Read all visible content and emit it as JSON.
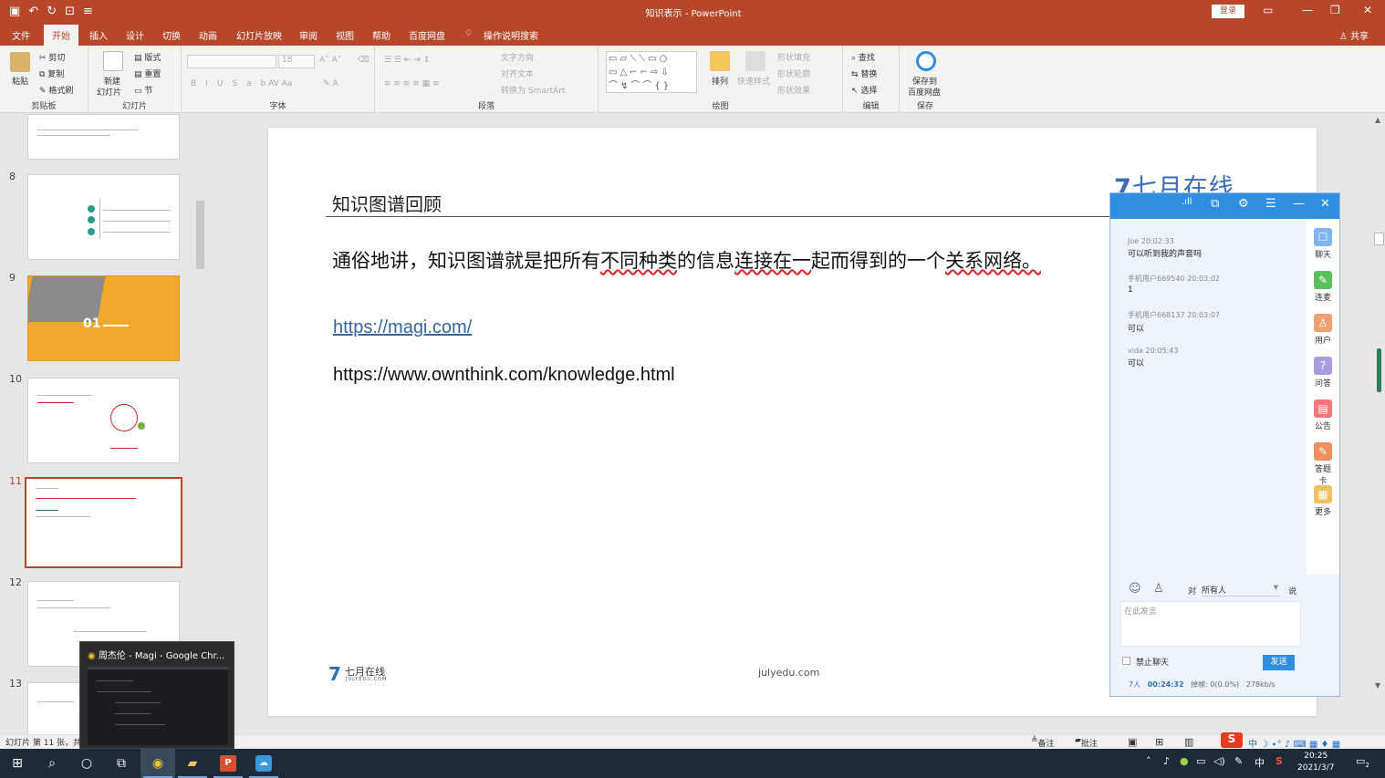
{
  "window": {
    "title": "知识表示 - PowerPoint",
    "login": "登录",
    "qat_icons": [
      "save-icon",
      "undo-icon",
      "redo-icon",
      "present-icon",
      "customize-icon"
    ]
  },
  "tabs": [
    "文件",
    "开始",
    "插入",
    "设计",
    "切换",
    "动画",
    "幻灯片放映",
    "审阅",
    "视图",
    "帮助",
    "百度网盘",
    "操作说明搜索"
  ],
  "share": "共享",
  "ribbon": {
    "clipboard": {
      "paste": "粘贴",
      "cut": "剪切",
      "copy": "复制",
      "format_painter": "格式刷",
      "label": "剪贴板"
    },
    "slides": {
      "new_slide": "新建",
      "new_slide2": "幻灯片",
      "layout": "版式",
      "reset": "重置",
      "section": "节",
      "label": "幻灯片"
    },
    "font": {
      "size": "18",
      "label": "字体"
    },
    "paragraph": {
      "text_direction": "文字方向",
      "align_text": "对齐文本",
      "smartart": "转换为 SmartArt",
      "label": "段落"
    },
    "drawing": {
      "arrange": "排列",
      "quick_styles": "快速样式",
      "fill": "形状填充",
      "outline": "形状轮廓",
      "effects": "形状效果",
      "label": "绘图"
    },
    "editing": {
      "find": "查找",
      "replace": "替换",
      "select": "选择",
      "label": "编辑"
    },
    "save": {
      "line1": "保存到",
      "line2": "百度网盘",
      "label": "保存"
    }
  },
  "thumbnails": [
    {
      "num": "8"
    },
    {
      "num": "9",
      "text": "01"
    },
    {
      "num": "10"
    },
    {
      "num": "11"
    },
    {
      "num": "12"
    },
    {
      "num": "13"
    }
  ],
  "slide": {
    "title": "知识图谱回顾",
    "body_parts": [
      "通俗地讲，知识图谱就是把所有",
      "不同种类",
      "的信息",
      "连接在一",
      "起而得到的一个",
      "关系网络。"
    ],
    "link": "https://magi.com/",
    "url2": "https://www.ownthink.com/knowledge.html",
    "brand": "七月在线",
    "footer_brand": "七月在线",
    "footer_sub": "JULYEDU.COM",
    "footer_url": "julyedu.com"
  },
  "chat": {
    "messages": [
      {
        "user": "Joe",
        "time": "20:02:33",
        "text": "可以听到我的声音吗"
      },
      {
        "user": "手机用户669540",
        "time": "20:03:02",
        "text": "1"
      },
      {
        "user": "手机用户668137",
        "time": "20:03:07",
        "text": "可以"
      },
      {
        "user": "vida",
        "time": "20:05:43",
        "text": "可以"
      }
    ],
    "tools": [
      "聊天",
      "连麦",
      "用户",
      "问答",
      "公告",
      "答题卡",
      "更多"
    ],
    "to": "对",
    "to_target": "所有人",
    "say": "说",
    "input_placeholder": "在此发言",
    "mute": "禁止聊天",
    "send": "发送",
    "status": {
      "users": "7人",
      "duration": "00:24:32",
      "loss": "掉帧: 0(0.0%)",
      "speed": "278kb/s"
    }
  },
  "preview": {
    "title": "周杰伦 - Magi - Google Chr..."
  },
  "statusbar": {
    "slide_info": "幻灯片 第 11 张，共",
    "notes": "备注",
    "comments": "批注"
  },
  "taskbar": {
    "time": "20:25",
    "date": "2021/3/7",
    "ime": "中",
    "notif": "2"
  },
  "colors": {
    "accent": "#b7472a",
    "chat_blue": "#2f8ee0",
    "link": "#3465a4",
    "underline_red": "#d9262c"
  }
}
